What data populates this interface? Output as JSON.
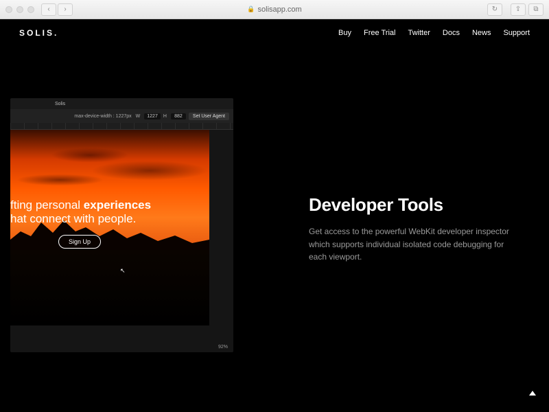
{
  "browser": {
    "url": "solisapp.com"
  },
  "header": {
    "logo": "SOLIS.",
    "nav": [
      "Buy",
      "Free Trial",
      "Twitter",
      "Docs",
      "News",
      "Support"
    ]
  },
  "app_preview": {
    "tab_label": "Solis",
    "toolbar": {
      "media_query_label": "max-device-width : 1227px",
      "w_label": "W",
      "w_value": "1227",
      "h_label": "H",
      "h_value": "882",
      "user_agent_btn": "Set User Agent"
    },
    "hero": {
      "line1_prefix": "fting personal ",
      "line1_bold": "experiences",
      "line2": "hat connect with people.",
      "signup": "Sign Up"
    },
    "zoom": "92%"
  },
  "feature": {
    "heading": "Developer Tools",
    "body": "Get access to the powerful WebKit developer inspector which supports individual isolated code debugging for each viewport."
  }
}
